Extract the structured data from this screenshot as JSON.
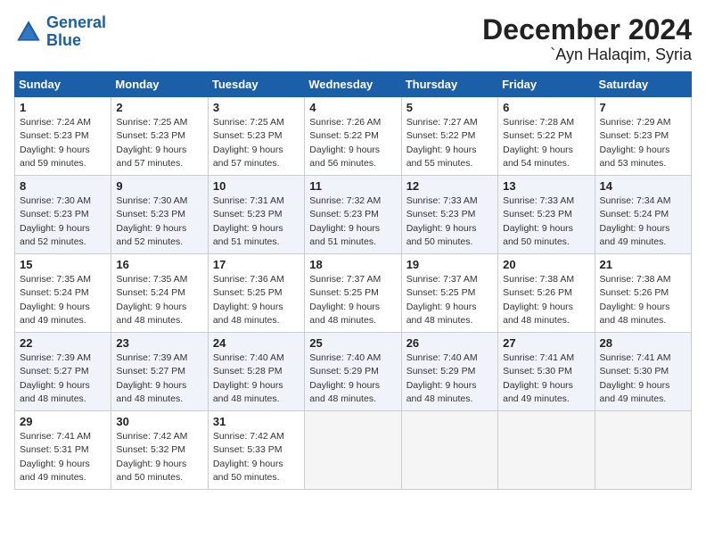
{
  "header": {
    "logo_line1": "General",
    "logo_line2": "Blue",
    "title": "December 2024",
    "subtitle": "`Ayn Halaqim, Syria"
  },
  "weekdays": [
    "Sunday",
    "Monday",
    "Tuesday",
    "Wednesday",
    "Thursday",
    "Friday",
    "Saturday"
  ],
  "weeks": [
    [
      {
        "day": "1",
        "info": "Sunrise: 7:24 AM\nSunset: 5:23 PM\nDaylight: 9 hours\nand 59 minutes."
      },
      {
        "day": "2",
        "info": "Sunrise: 7:25 AM\nSunset: 5:23 PM\nDaylight: 9 hours\nand 57 minutes."
      },
      {
        "day": "3",
        "info": "Sunrise: 7:25 AM\nSunset: 5:23 PM\nDaylight: 9 hours\nand 57 minutes."
      },
      {
        "day": "4",
        "info": "Sunrise: 7:26 AM\nSunset: 5:22 PM\nDaylight: 9 hours\nand 56 minutes."
      },
      {
        "day": "5",
        "info": "Sunrise: 7:27 AM\nSunset: 5:22 PM\nDaylight: 9 hours\nand 55 minutes."
      },
      {
        "day": "6",
        "info": "Sunrise: 7:28 AM\nSunset: 5:22 PM\nDaylight: 9 hours\nand 54 minutes."
      },
      {
        "day": "7",
        "info": "Sunrise: 7:29 AM\nSunset: 5:23 PM\nDaylight: 9 hours\nand 53 minutes."
      }
    ],
    [
      {
        "day": "8",
        "info": "Sunrise: 7:30 AM\nSunset: 5:23 PM\nDaylight: 9 hours\nand 52 minutes."
      },
      {
        "day": "9",
        "info": "Sunrise: 7:30 AM\nSunset: 5:23 PM\nDaylight: 9 hours\nand 52 minutes."
      },
      {
        "day": "10",
        "info": "Sunrise: 7:31 AM\nSunset: 5:23 PM\nDaylight: 9 hours\nand 51 minutes."
      },
      {
        "day": "11",
        "info": "Sunrise: 7:32 AM\nSunset: 5:23 PM\nDaylight: 9 hours\nand 51 minutes."
      },
      {
        "day": "12",
        "info": "Sunrise: 7:33 AM\nSunset: 5:23 PM\nDaylight: 9 hours\nand 50 minutes."
      },
      {
        "day": "13",
        "info": "Sunrise: 7:33 AM\nSunset: 5:23 PM\nDaylight: 9 hours\nand 50 minutes."
      },
      {
        "day": "14",
        "info": "Sunrise: 7:34 AM\nSunset: 5:24 PM\nDaylight: 9 hours\nand 49 minutes."
      }
    ],
    [
      {
        "day": "15",
        "info": "Sunrise: 7:35 AM\nSunset: 5:24 PM\nDaylight: 9 hours\nand 49 minutes."
      },
      {
        "day": "16",
        "info": "Sunrise: 7:35 AM\nSunset: 5:24 PM\nDaylight: 9 hours\nand 48 minutes."
      },
      {
        "day": "17",
        "info": "Sunrise: 7:36 AM\nSunset: 5:25 PM\nDaylight: 9 hours\nand 48 minutes."
      },
      {
        "day": "18",
        "info": "Sunrise: 7:37 AM\nSunset: 5:25 PM\nDaylight: 9 hours\nand 48 minutes."
      },
      {
        "day": "19",
        "info": "Sunrise: 7:37 AM\nSunset: 5:25 PM\nDaylight: 9 hours\nand 48 minutes."
      },
      {
        "day": "20",
        "info": "Sunrise: 7:38 AM\nSunset: 5:26 PM\nDaylight: 9 hours\nand 48 minutes."
      },
      {
        "day": "21",
        "info": "Sunrise: 7:38 AM\nSunset: 5:26 PM\nDaylight: 9 hours\nand 48 minutes."
      }
    ],
    [
      {
        "day": "22",
        "info": "Sunrise: 7:39 AM\nSunset: 5:27 PM\nDaylight: 9 hours\nand 48 minutes."
      },
      {
        "day": "23",
        "info": "Sunrise: 7:39 AM\nSunset: 5:27 PM\nDaylight: 9 hours\nand 48 minutes."
      },
      {
        "day": "24",
        "info": "Sunrise: 7:40 AM\nSunset: 5:28 PM\nDaylight: 9 hours\nand 48 minutes."
      },
      {
        "day": "25",
        "info": "Sunrise: 7:40 AM\nSunset: 5:29 PM\nDaylight: 9 hours\nand 48 minutes."
      },
      {
        "day": "26",
        "info": "Sunrise: 7:40 AM\nSunset: 5:29 PM\nDaylight: 9 hours\nand 48 minutes."
      },
      {
        "day": "27",
        "info": "Sunrise: 7:41 AM\nSunset: 5:30 PM\nDaylight: 9 hours\nand 49 minutes."
      },
      {
        "day": "28",
        "info": "Sunrise: 7:41 AM\nSunset: 5:30 PM\nDaylight: 9 hours\nand 49 minutes."
      }
    ],
    [
      {
        "day": "29",
        "info": "Sunrise: 7:41 AM\nSunset: 5:31 PM\nDaylight: 9 hours\nand 49 minutes."
      },
      {
        "day": "30",
        "info": "Sunrise: 7:42 AM\nSunset: 5:32 PM\nDaylight: 9 hours\nand 50 minutes."
      },
      {
        "day": "31",
        "info": "Sunrise: 7:42 AM\nSunset: 5:33 PM\nDaylight: 9 hours\nand 50 minutes."
      },
      null,
      null,
      null,
      null
    ]
  ]
}
